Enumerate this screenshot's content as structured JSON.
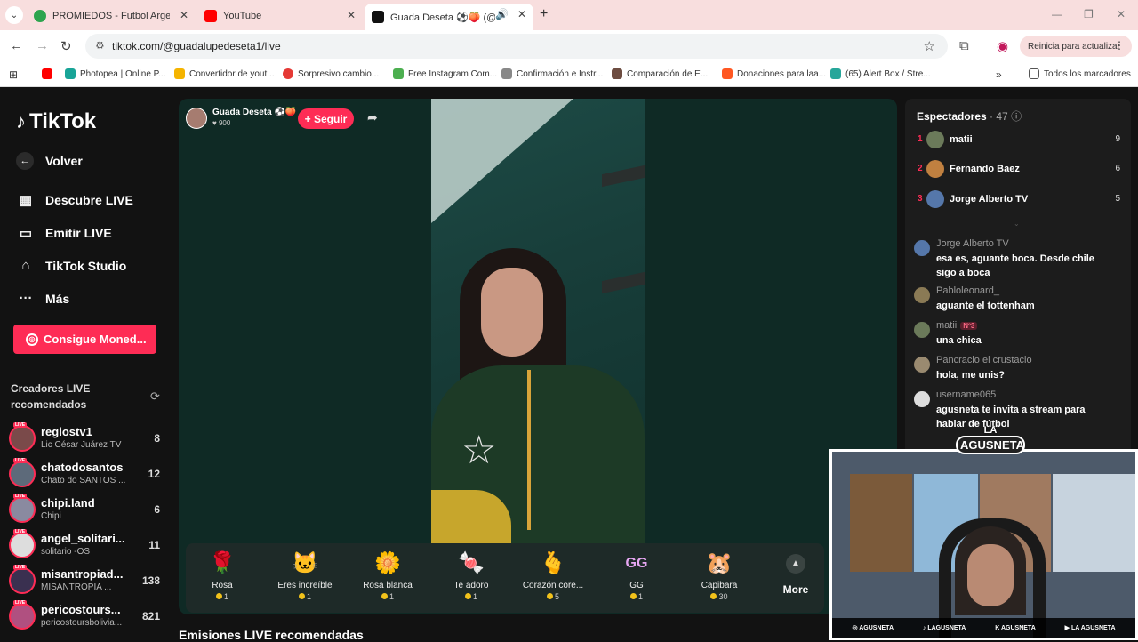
{
  "browser": {
    "tabs": [
      {
        "title": "PROMIEDOS - Futbol Argentino",
        "favicon_color": "#2da44e"
      },
      {
        "title": "YouTube",
        "favicon_color": "#ff0000"
      },
      {
        "title": "Guada Deseta ⚽🍑 (@gua",
        "favicon_color": "#111111"
      }
    ],
    "url": "tiktok.com/@guadalupedeseta1/live",
    "update_label": "Reinicia para actualizar",
    "bookmarks": [
      {
        "label": "",
        "color": "#ff0000"
      },
      {
        "label": "Photopea | Online P...",
        "color": "#18a497"
      },
      {
        "label": "Convertidor de yout...",
        "color": "#f5b400"
      },
      {
        "label": "Sorpresivo cambio...",
        "color": "#e53935"
      },
      {
        "label": "Free Instagram Com...",
        "color": "#4caf50"
      },
      {
        "label": "Confirmación e Instr...",
        "color": "#888888"
      },
      {
        "label": "Comparación de E...",
        "color": "#6d4c41"
      },
      {
        "label": "Donaciones para laa...",
        "color": "#ff5722"
      },
      {
        "label": "(65) Alert Box / Stre...",
        "color": "#26a69a"
      }
    ],
    "all_bookmarks_label": "Todos los marcadores"
  },
  "sidebar": {
    "logo": "TikTok",
    "back_label": "Volver",
    "nav": [
      {
        "label": "Descubre LIVE",
        "icon": "calendar-live-icon"
      },
      {
        "label": "Emitir LIVE",
        "icon": "video-camera-icon"
      },
      {
        "label": "TikTok Studio",
        "icon": "studio-icon"
      },
      {
        "label": "Más",
        "icon": "more-dots-icon"
      }
    ],
    "coins_button": "Consigue Moned...",
    "recommended_title": "Creadores LIVE recomendados",
    "creators": [
      {
        "name": "regiostv1",
        "sub": "Lic César Juárez TV",
        "count": "8"
      },
      {
        "name": "chatodosantos",
        "sub": "Chato do SANTOS ...",
        "count": "12"
      },
      {
        "name": "chipi.land",
        "sub": "Chipi",
        "count": "6"
      },
      {
        "name": "angel_solitari...",
        "sub": "solitario -OS",
        "count": "11"
      },
      {
        "name": "misantropiad...",
        "sub": "MISANTROPIA ...",
        "count": "138"
      },
      {
        "name": "pericostours...",
        "sub": "pericostoursbolivia...",
        "count": "821"
      }
    ]
  },
  "stream": {
    "host_name": "Guada Deseta ⚽🍑",
    "host_likes": "900",
    "follow_label": "+ Seguir",
    "gifts": [
      {
        "name": "Rosa",
        "price": "1",
        "icon": "🌹"
      },
      {
        "name": "Eres increíble",
        "price": "1",
        "icon": "🐱"
      },
      {
        "name": "Rosa blanca",
        "price": "1",
        "icon": "🌼"
      },
      {
        "name": "Te adoro",
        "price": "1",
        "icon": "🍬"
      },
      {
        "name": "Corazón core...",
        "price": "5",
        "icon": "🫰"
      },
      {
        "name": "GG",
        "price": "1",
        "icon": "GG"
      },
      {
        "name": "Capibara",
        "price": "30",
        "icon": "🐹"
      }
    ],
    "more_label": "More",
    "recommended_heading": "Emisiones LIVE recomendadas"
  },
  "viewers": {
    "title": "Espectadores",
    "count": "· 47",
    "top": [
      {
        "rank": "1",
        "name": "matii",
        "score": "9"
      },
      {
        "rank": "2",
        "name": "Fernando Baez",
        "score": "6"
      },
      {
        "rank": "3",
        "name": "Jorge Alberto TV",
        "score": "5"
      }
    ]
  },
  "chat": [
    {
      "user": "Jorge Alberto TV",
      "msg": "esa es, aguante boca. Desde chile sigo a boca",
      "badge": ""
    },
    {
      "user": "Pabloleonard_",
      "msg": "aguante el tottenham",
      "badge": ""
    },
    {
      "user": "matii",
      "msg": "una chica",
      "badge": "Nº3"
    },
    {
      "user": "Pancracio el crustacio",
      "msg": "hola, me unis?",
      "badge": ""
    },
    {
      "user": "username065",
      "msg": "agusneta te invita a stream para hablar de fútbol",
      "badge": ""
    }
  ],
  "webcam": {
    "logo_top": "LA",
    "logo_main": "AGUSNETA",
    "socials": [
      "AGUSNETA",
      "LAGUSNETA",
      "AGUSNETA",
      "LA AGUSNETA"
    ]
  }
}
